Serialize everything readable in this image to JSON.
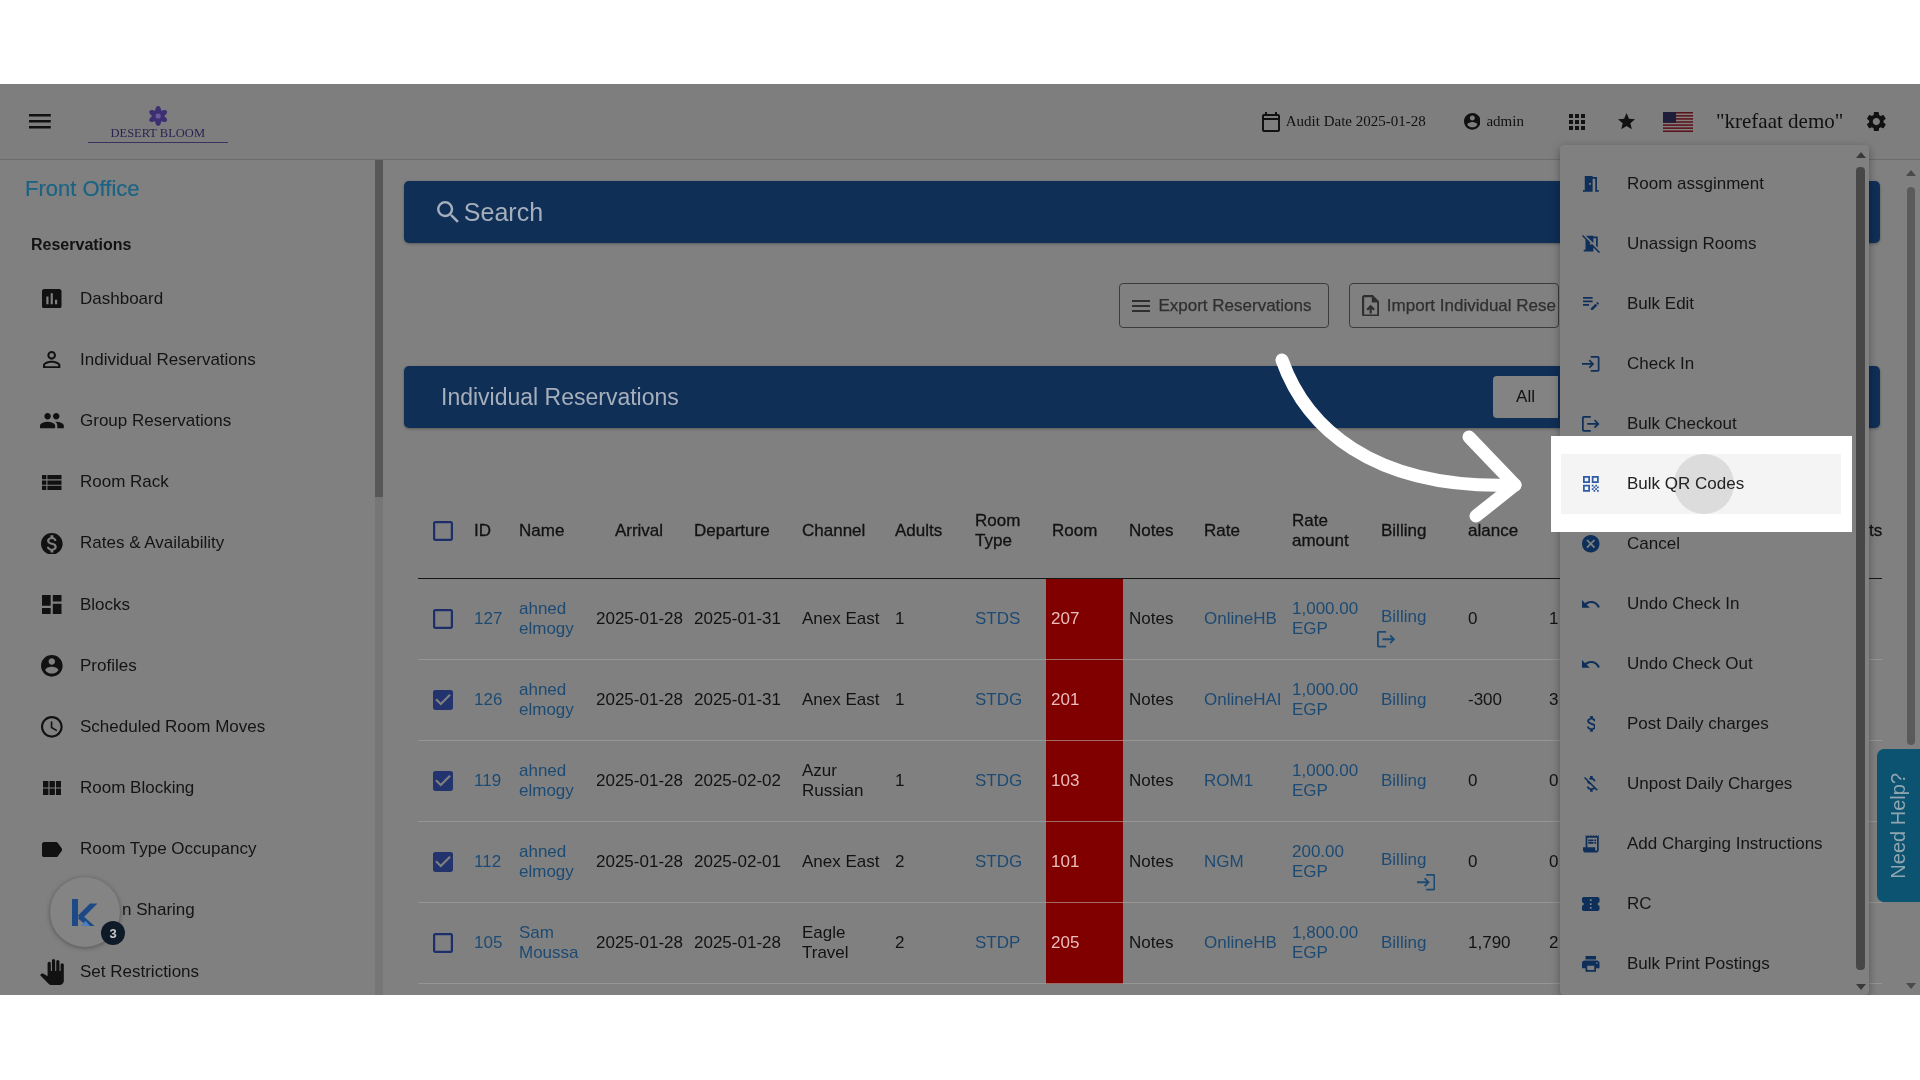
{
  "top_bar": {
    "logo_text": "DESERT BLOOM",
    "audit_date": "Audit Date 2025-01-28",
    "user": "admin",
    "company": "\"krefaat demo\""
  },
  "sidebar": {
    "section": "Front Office",
    "group": "Reservations",
    "items": [
      {
        "label": "Dashboard"
      },
      {
        "label": "Individual Reservations"
      },
      {
        "label": "Group Reservations"
      },
      {
        "label": "Room Rack"
      },
      {
        "label": "Rates & Availability"
      },
      {
        "label": "Blocks"
      },
      {
        "label": "Profiles"
      },
      {
        "label": "Scheduled Room Moves"
      },
      {
        "label": "Room Blocking"
      },
      {
        "label": "Room Type Occupancy"
      },
      {
        "label": "n Sharing"
      },
      {
        "label": "Set Restrictions"
      }
    ]
  },
  "search_panel": {
    "title": "Search"
  },
  "toolbar": {
    "buttons": [
      {
        "label": "Export Reservations"
      },
      {
        "label": "Import Individual Rese"
      }
    ]
  },
  "reservations_panel": {
    "title": "Individual Reservations",
    "filter_tabs": [
      {
        "label": "All"
      }
    ]
  },
  "table": {
    "select_all": {
      "checked": false
    },
    "columns": {
      "id": "ID",
      "name": "Name",
      "arrival": "Arrival",
      "departure": "Departure",
      "channel": "Channel",
      "adults": "Adults",
      "room_type": "Room Type",
      "room": "Room",
      "notes": "Notes",
      "rate": "Rate",
      "rate_amount": "Rate amount",
      "billing": "Billing",
      "column_13": "alance",
      "column_15": "ts"
    },
    "rows": [
      {
        "checked": false,
        "id": "127",
        "name": "ahned elmogy",
        "arrival": "2025-01-28",
        "departure": "2025-01-31",
        "channel": "Anex East",
        "adults": "1",
        "room_type": "STDS",
        "room": "207",
        "color": "#800000",
        "notes": "Notes",
        "rate": "OnlineHB",
        "rate_amount": "1,000.00 EGP",
        "billing": "Billing",
        "column_13": "0",
        "column_14": "1"
      },
      {
        "checked": true,
        "id": "126",
        "name": "ahned elmogy",
        "arrival": "2025-01-28",
        "departure": "2025-01-31",
        "channel": "Anex East",
        "adults": "1",
        "room_type": "STDG",
        "room": "201",
        "color": "#800000",
        "notes": "Notes",
        "rate": "OnlineHAI",
        "rate_amount": "1,000.00 EGP",
        "billing": "Billing",
        "column_13": "-300",
        "column_14": "3"
      },
      {
        "checked": true,
        "id": "119",
        "name": "ahned elmogy",
        "arrival": "2025-01-28",
        "departure": "2025-02-02",
        "channel": "Azur Russian",
        "adults": "1",
        "room_type": "STDG",
        "room": "103",
        "color": "#800000",
        "notes": "Notes",
        "rate": "ROM1",
        "rate_amount": "1,000.00 EGP",
        "billing": "Billing",
        "column_13": "0",
        "column_14": "0"
      },
      {
        "checked": true,
        "id": "112",
        "name": "ahned elmogy",
        "arrival": "2025-01-28",
        "departure": "2025-02-01",
        "channel": "Anex East",
        "adults": "2",
        "room_type": "STDG",
        "room": "101",
        "color": "#800000",
        "notes": "Notes",
        "rate": "NGM",
        "rate_amount": "200.00 EGP",
        "billing": "Billing",
        "column_13": "0",
        "column_14": "0"
      },
      {
        "checked": false,
        "id": "105",
        "name": "Sam Moussa",
        "arrival": "2025-01-28",
        "departure": "2025-01-28",
        "channel": "Eagle Travel",
        "adults": "2",
        "room_type": "STDP",
        "room": "205",
        "color": "#800000",
        "notes": "Notes",
        "rate": "OnlineHB",
        "rate_amount": "1,800.00 EGP",
        "billing": "Billing",
        "column_13": "1,790",
        "column_14": "2"
      }
    ]
  },
  "action_menu": {
    "items": [
      {
        "label": "Room assginment",
        "selected": false
      },
      {
        "label": "Unassign Rooms",
        "selected": false
      },
      {
        "label": "Bulk Edit",
        "selected": false
      },
      {
        "label": "Check In",
        "selected": false
      },
      {
        "label": "Bulk Checkout",
        "selected": false
      },
      {
        "label": "Bulk QR Codes",
        "selected": true
      },
      {
        "label": "Cancel",
        "selected": false
      },
      {
        "label": "Undo Check In",
        "selected": false
      },
      {
        "label": "Undo Check Out",
        "selected": false
      },
      {
        "label": "Post Daily charges",
        "selected": false
      },
      {
        "label": "Unpost Daily Charges",
        "selected": false
      },
      {
        "label": "Add Charging Instructions",
        "selected": false
      },
      {
        "label": "RC",
        "selected": false
      },
      {
        "label": "Bulk Print Postings",
        "selected": false
      }
    ]
  },
  "help_tab": {
    "label": "Need Help?"
  },
  "chat_widget": {
    "badge": "3"
  }
}
